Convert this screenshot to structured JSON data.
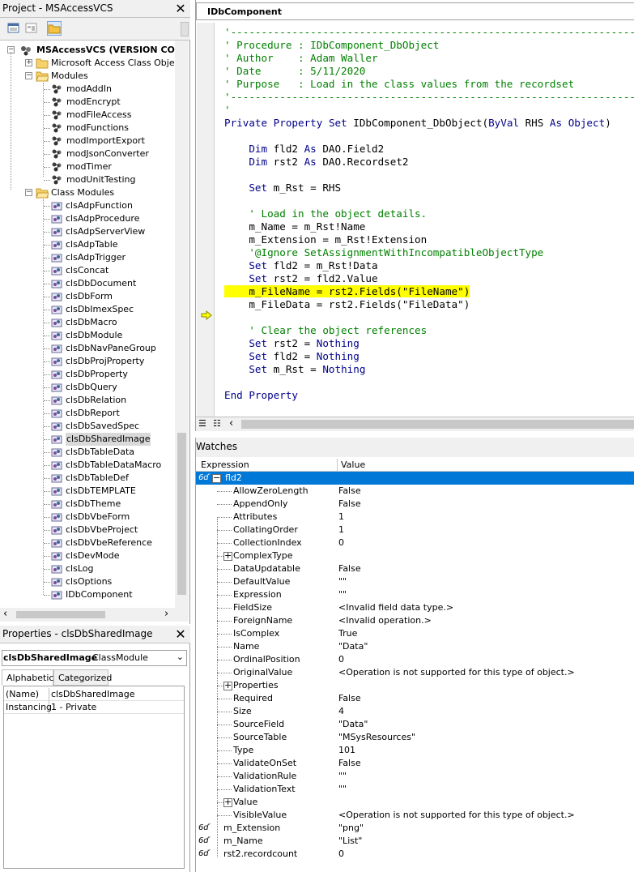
{
  "project": {
    "title": "Project - MSAccessVCS",
    "root": "MSAccessVCS (VERSION CONTR",
    "microsoft_objects": "Microsoft Access Class Objects",
    "modules_folder": "Modules",
    "modules": [
      "modAddIn",
      "modEncrypt",
      "modFileAccess",
      "modFunctions",
      "modImportExport",
      "modJsonConverter",
      "modTimer",
      "modUnitTesting"
    ],
    "class_folder": "Class Modules",
    "classes": [
      "clsAdpFunction",
      "clsAdpProcedure",
      "clsAdpServerView",
      "clsAdpTable",
      "clsAdpTrigger",
      "clsConcat",
      "clsDbDocument",
      "clsDbForm",
      "clsDbImexSpec",
      "clsDbMacro",
      "clsDbModule",
      "clsDbNavPaneGroup",
      "clsDbProjProperty",
      "clsDbProperty",
      "clsDbQuery",
      "clsDbRelation",
      "clsDbReport",
      "clsDbSavedSpec",
      "clsDbSharedImage",
      "clsDbTableData",
      "clsDbTableDataMacro",
      "clsDbTableDef",
      "clsDbTEMPLATE",
      "clsDbTheme",
      "clsDbVbeForm",
      "clsDbVbeProject",
      "clsDbVbeReference",
      "clsDevMode",
      "clsLog",
      "clsOptions",
      "IDbComponent"
    ]
  },
  "properties": {
    "title": "Properties - clsDbSharedImage",
    "object_name": "clsDbSharedImage",
    "object_type": "ClassModule",
    "tabs": [
      "Alphabetic",
      "Categorized"
    ],
    "rows": [
      {
        "k": "(Name)",
        "v": "clsDbSharedImage"
      },
      {
        "k": "Instancing",
        "v": "1 - Private"
      }
    ]
  },
  "code": {
    "title": "IDbComponent",
    "lines": [
      "'---------------------------------------------------------------------------------------",
      "' Procedure : IDbComponent_DbObject",
      "' Author    : Adam Waller",
      "' Date      : 5/11/2020",
      "' Purpose   : Load in the class values from the recordset",
      "'---------------------------------------------------------------------------------------",
      "'",
      "Private Property Set IDbComponent_DbObject(ByVal RHS As Object)",
      "",
      "    Dim fld2 As DAO.Field2",
      "    Dim rst2 As DAO.Recordset2",
      "",
      "    Set m_Rst = RHS",
      "",
      "    ' Load in the object details.",
      "    m_Name = m_Rst!Name",
      "    m_Extension = m_Rst!Extension",
      "    '@Ignore SetAssignmentWithIncompatibleObjectType",
      "    Set fld2 = m_Rst!Data",
      "    Set rst2 = fld2.Value",
      "    m_FileName = rst2.Fields(\"FileName\")",
      "    m_FileData = rst2.Fields(\"FileData\")",
      "",
      "    ' Clear the object references",
      "    Set rst2 = Nothing",
      "    Set fld2 = Nothing",
      "    Set m_Rst = Nothing",
      "",
      "End Property"
    ]
  },
  "watches": {
    "title": "Watches",
    "col_expression": "Expression",
    "col_value": "Value",
    "root": "fld2",
    "children": [
      {
        "name": "AllowZeroLength",
        "value": "False"
      },
      {
        "name": "AppendOnly",
        "value": "False"
      },
      {
        "name": "Attributes",
        "value": "1"
      },
      {
        "name": "CollatingOrder",
        "value": "1"
      },
      {
        "name": "CollectionIndex",
        "value": "0"
      },
      {
        "name": "ComplexType",
        "value": ""
      },
      {
        "name": "DataUpdatable",
        "value": "False"
      },
      {
        "name": "DefaultValue",
        "value": "\"\""
      },
      {
        "name": "Expression",
        "value": "\"\""
      },
      {
        "name": "FieldSize",
        "value": "<Invalid field data type.>"
      },
      {
        "name": "ForeignName",
        "value": "<Invalid operation.>"
      },
      {
        "name": "IsComplex",
        "value": "True"
      },
      {
        "name": "Name",
        "value": "\"Data\""
      },
      {
        "name": "OrdinalPosition",
        "value": "0"
      },
      {
        "name": "OriginalValue",
        "value": "<Operation is not supported for this type of object.>"
      },
      {
        "name": "Properties",
        "value": ""
      },
      {
        "name": "Required",
        "value": "False"
      },
      {
        "name": "Size",
        "value": "4"
      },
      {
        "name": "SourceField",
        "value": "\"Data\""
      },
      {
        "name": "SourceTable",
        "value": "\"MSysResources\""
      },
      {
        "name": "Type",
        "value": "101"
      },
      {
        "name": "ValidateOnSet",
        "value": "False"
      },
      {
        "name": "ValidationRule",
        "value": "\"\""
      },
      {
        "name": "ValidationText",
        "value": "\"\""
      },
      {
        "name": "Value",
        "value": ""
      },
      {
        "name": "VisibleValue",
        "value": "<Operation is not supported for this type of object.>"
      }
    ],
    "others": [
      {
        "name": "m_Extension",
        "value": "\"png\""
      },
      {
        "name": "m_Name",
        "value": "\"List\""
      },
      {
        "name": "rst2.recordcount",
        "value": "0"
      }
    ]
  }
}
